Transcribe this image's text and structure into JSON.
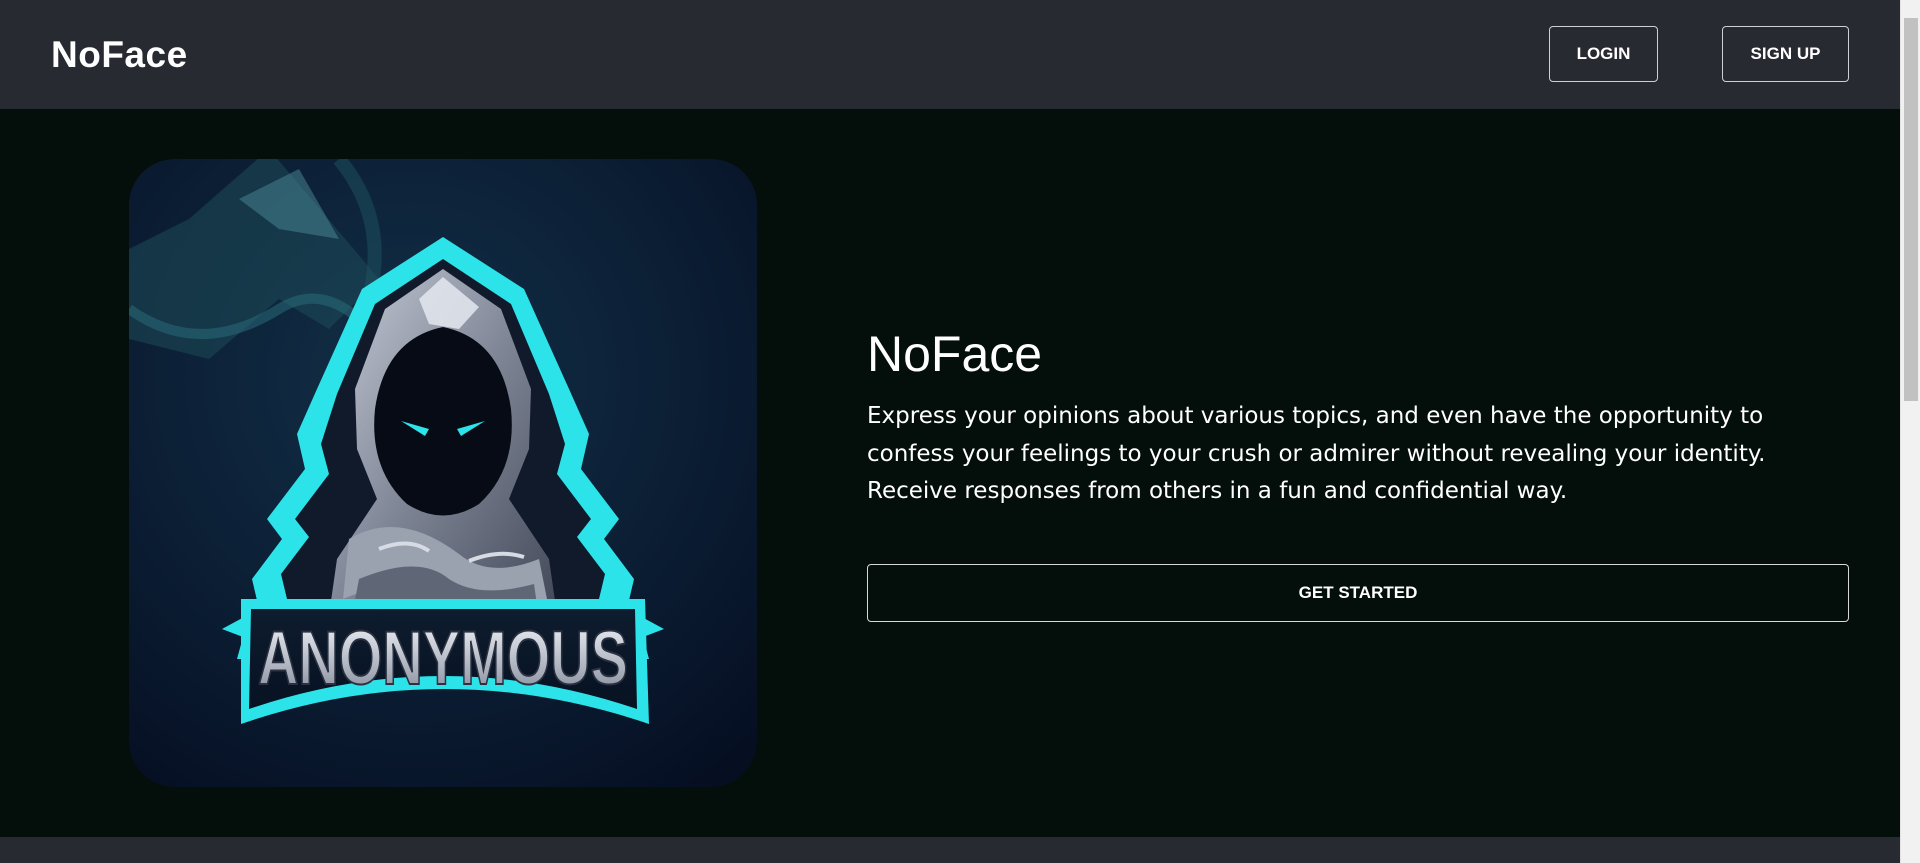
{
  "navbar": {
    "brand": "NoFace",
    "login_label": "LOGIN",
    "signup_label": "SIGN UP"
  },
  "hero": {
    "image_text": "ANONYMOUS",
    "title": "NoFace",
    "description": "Express your opinions about various topics, and even have the opportunity to confess your feelings to your crush or admirer without revealing your identity. Receive responses from others in a fun and confidential way.",
    "cta_label": "GET STARTED"
  },
  "colors": {
    "navbar_bg": "#282a31",
    "hero_bg": "#040e0a",
    "accent_cyan": "#2de3ea",
    "text": "#ffffff"
  },
  "icons": {
    "hero_image": "hooded-anonymous-mascot-logo"
  }
}
